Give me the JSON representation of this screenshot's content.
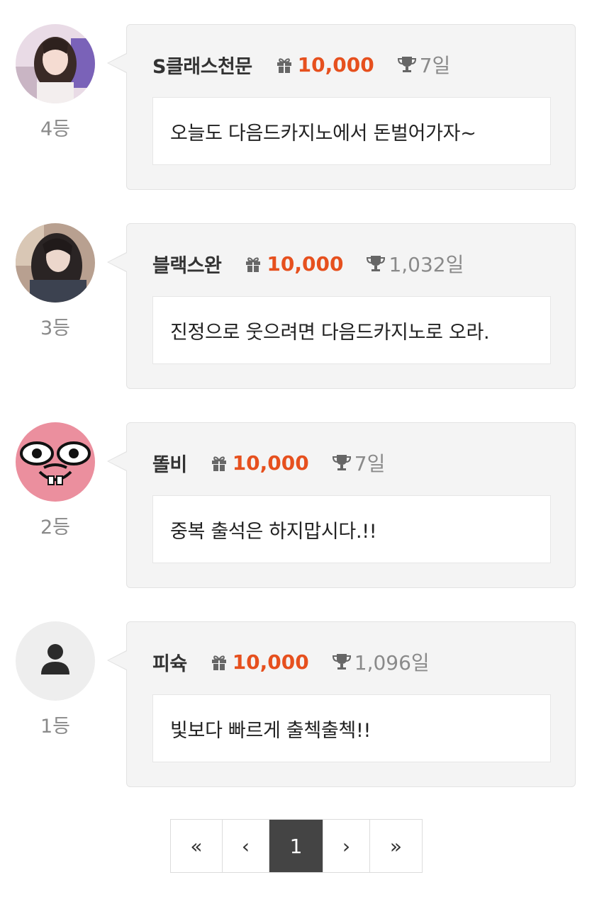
{
  "entries": [
    {
      "rank": "4등",
      "name": "S클래스천문",
      "points": "10,000",
      "days": "7일",
      "message": "오늘도 다음드카지노에서 돈벌어가자~",
      "avatar": "photo"
    },
    {
      "rank": "3등",
      "name": "블랙스완",
      "points": "10,000",
      "days": "1,032일",
      "message": "진정으로 웃으려면 다음드카지노로 오라.",
      "avatar": "photo"
    },
    {
      "rank": "2등",
      "name": "똘비",
      "points": "10,000",
      "days": "7일",
      "message": "중복 출석은 하지맙시다.!!",
      "avatar": "cartoon"
    },
    {
      "rank": "1등",
      "name": "피슉",
      "points": "10,000",
      "days": "1,096일",
      "message": "빛보다 빠르게 출첵출첵!!",
      "avatar": "default-user-icon"
    }
  ],
  "pagination": {
    "first": "«",
    "prev": "‹",
    "current": "1",
    "next": "›",
    "last": "»"
  },
  "colors": {
    "points": "#e6501e",
    "card_bg": "#f4f4f4",
    "active_page": "#444444"
  }
}
